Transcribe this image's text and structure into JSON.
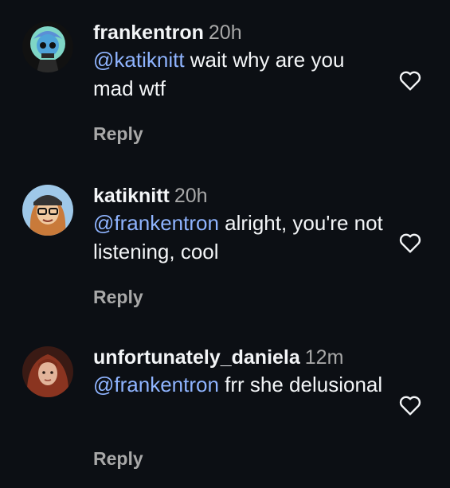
{
  "comments": [
    {
      "username": "frankentron",
      "time": "20h",
      "mention": "@katiknitt",
      "text": " wait why are you mad wtf",
      "reply_label": "Reply",
      "like_icon": "heart-outline-icon"
    },
    {
      "username": "katiknitt",
      "time": "20h",
      "mention": "@frankentron",
      "text": " alright, you're not listening, cool",
      "reply_label": "Reply",
      "like_icon": "heart-outline-icon"
    },
    {
      "username": "unfortunately_daniela",
      "time": "12m",
      "mention": "@frankentron",
      "text": " frr she delusional",
      "reply_label": "Reply",
      "like_icon": "heart-outline-icon"
    }
  ],
  "colors": {
    "background": "#0c0f14",
    "text": "#f3f5f7",
    "muted": "#a8a8a8",
    "mention": "#8fb4ff"
  }
}
